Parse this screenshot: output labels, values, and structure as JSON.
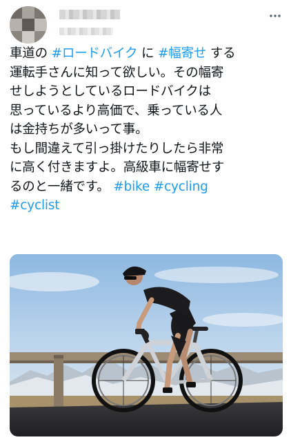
{
  "tweet": {
    "author": {
      "avatar_icon": "avatar-blurred",
      "more_icon": "more-options-icon"
    },
    "lines": [
      [
        {
          "t": "車道の "
        },
        {
          "t": "#ロードバイク",
          "tag": true
        },
        {
          "t": " に "
        },
        {
          "t": "#幅寄せ",
          "tag": true
        },
        {
          "t": " する"
        }
      ],
      [
        {
          "t": "運転手さんに知って欲しい。その幅寄"
        }
      ],
      [
        {
          "t": "せしようとしているロードバイクは"
        }
      ],
      [
        {
          "t": "思っているより高価で、乗っている人"
        }
      ],
      [
        {
          "t": "は金持ちが多いって事。"
        }
      ],
      [
        {
          "t": "もし間違えて引っ掛けたりしたら非常"
        }
      ],
      [
        {
          "t": "に高く付きますよ。高級車に幅寄せす"
        }
      ],
      [
        {
          "t": "るのと一緒です。 "
        },
        {
          "t": "#bike",
          "tag": true
        },
        {
          "t": " "
        },
        {
          "t": "#cycling",
          "tag": true
        }
      ],
      [
        {
          "t": "#cyclist",
          "tag": true
        }
      ]
    ],
    "media": {
      "type": "photo",
      "subject": "cyclist on road bike"
    }
  },
  "colors": {
    "text": "#0f1419",
    "hashtag": "#1d9bf0",
    "background": "#ffffff"
  }
}
